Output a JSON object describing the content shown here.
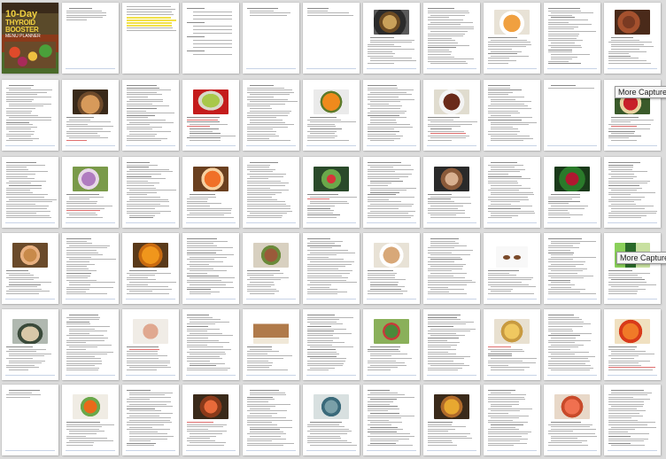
{
  "view": "page thumbnails grid",
  "cover": {
    "line1": "10-Day",
    "line2": "THYROID",
    "line3": "BOOSTER",
    "line4": "MENU PLANNER"
  },
  "overlays": [
    {
      "label": "More Capture Ty"
    },
    {
      "label": "More Capture T"
    }
  ],
  "photos": [
    "skillet",
    "soup",
    "meat",
    "muffin",
    "guac",
    "pumpkin",
    "beans",
    "apple",
    "onion",
    "sauce",
    "salad",
    "chicken",
    "berries",
    "bowl",
    "squash",
    "steak",
    "rice",
    "nuts",
    "juice",
    "fish",
    "oats",
    "pancake",
    "greens",
    "cheese",
    "peach",
    "carrot",
    "shrimp",
    "stew",
    "paella",
    "salmon"
  ]
}
